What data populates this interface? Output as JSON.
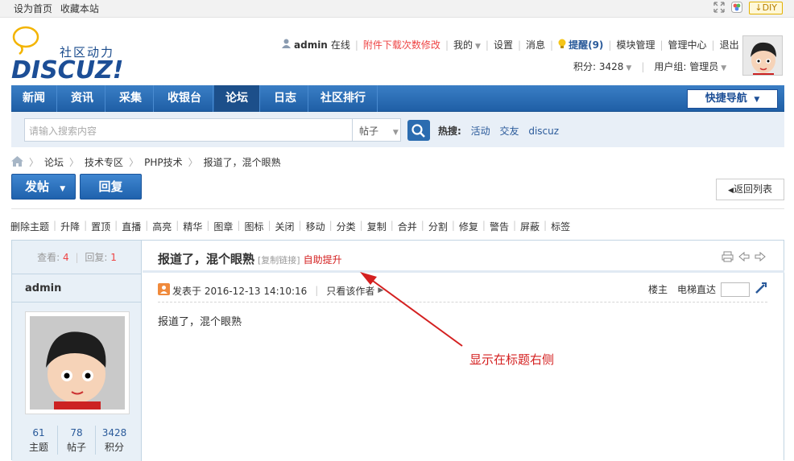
{
  "topbar": {
    "set_home": "设为首页",
    "bookmark": "收藏本站",
    "diy": "DIY"
  },
  "logo": {
    "slogan": "社区动力",
    "word": "DISCUZ!"
  },
  "userbar": {
    "username": "admin",
    "status": "在线",
    "download_link": "附件下载次数修改",
    "mine": "我的",
    "settings": "设置",
    "messages": "消息",
    "remind": "提醒(9)",
    "module_manage": "模块管理",
    "admin_center": "管理中心",
    "logout": "退出",
    "points": "积分: 3428",
    "usergroup": "用户组: 管理员"
  },
  "nav": {
    "items": [
      "新闻",
      "资讯",
      "采集",
      "收银台",
      "论坛",
      "日志",
      "社区排行"
    ],
    "active": "论坛",
    "quick_nav": "快捷导航"
  },
  "search": {
    "placeholder": "请输入搜索内容",
    "type": "帖子",
    "hot_label": "热搜:",
    "hot_keywords": [
      "活动",
      "交友",
      "discuz"
    ]
  },
  "breadcrumb": [
    "论坛",
    "技术专区",
    "PHP技术",
    "报道了，混个眼熟"
  ],
  "buttons": {
    "post": "发帖",
    "reply": "回复",
    "back": "返回列表"
  },
  "mod_tools": [
    "删除主题",
    "升降",
    "置顶",
    "直播",
    "高亮",
    "精华",
    "图章",
    "图标",
    "关闭",
    "移动",
    "分类",
    "复制",
    "合并",
    "分割",
    "修复",
    "警告",
    "屏蔽",
    "标签"
  ],
  "thread": {
    "views_label": "查看:",
    "views": "4",
    "replies_label": "回复:",
    "replies": "1",
    "title": "报道了，混个眼熟",
    "copy_link": "[复制链接]",
    "self_bump": "自助提升",
    "author": "admin",
    "posted_at": "发表于 2016-12-13 14:10:16",
    "only_author": "只看该作者",
    "floor": "楼主",
    "jump_label": "电梯直达",
    "content": "报道了，混个眼熟"
  },
  "author_stats": [
    {
      "value": "61",
      "label": "主题"
    },
    {
      "value": "78",
      "label": "帖子"
    },
    {
      "value": "3428",
      "label": "积分"
    }
  ],
  "annotation": "显示在标题右侧",
  "colors": {
    "nav_blue": "#2b6cb0",
    "accent_red": "#d42020",
    "link_blue": "#2a5a9a"
  }
}
